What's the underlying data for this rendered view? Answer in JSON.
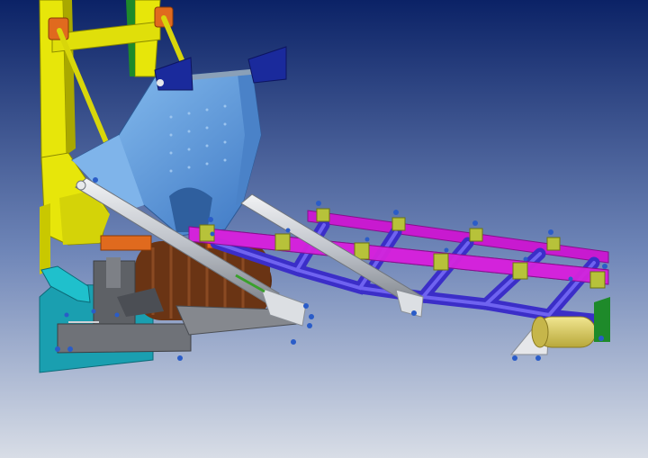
{
  "scene": {
    "kind": "CAD 3D render of conveyor / feeder machinery assembly",
    "background": {
      "top": "#0b2266",
      "middle": "#6f86b8",
      "bottom": "#d8dde6"
    },
    "colors": {
      "frame_yellow": "#e7e60a",
      "frame_yellow_dark": "#a9a800",
      "hopper_blue": "#5c9fe0",
      "hopper_blue_dark": "#3a6fb4",
      "bracket_navy": "#1a2a9c",
      "roller_purple": "#3b2ec8",
      "roller_purple_dark": "#241c86",
      "rail_magenta": "#c81ad0",
      "rail_magenta_dark": "#86108c",
      "clamp_olive": "#b7c23a",
      "cylinder_gray": "#c9ccd2",
      "base_gray": "#6f7278",
      "base_gray_dark": "#4b4e54",
      "drum_brown": "#5a2b10",
      "drum_brown_light": "#8a4a22",
      "orange_part": "#e06a1e",
      "teal_plate": "#1a9fb0",
      "idler_yellow": "#d9c84a",
      "green_part": "#1e8a2a",
      "bolt_blue": "#2a5cc8"
    },
    "parts": [
      "yellow-frame",
      "hopper",
      "top-bracket",
      "tie-rod",
      "hydraulic-cylinder-left",
      "hydraulic-cylinder-right",
      "drum",
      "base-frame",
      "purple-rollers",
      "magenta-rails",
      "rail-clamps",
      "end-idler",
      "teal-plate",
      "bolts"
    ]
  }
}
